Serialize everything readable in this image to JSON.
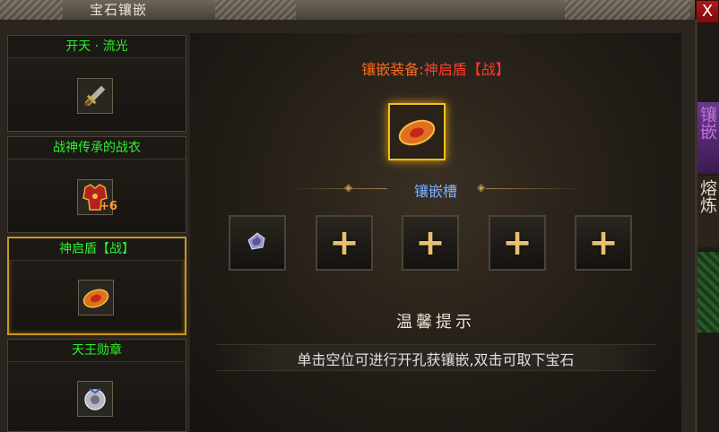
{
  "window": {
    "title": "宝石镶嵌",
    "close_label": "X"
  },
  "sidebar": {
    "items": [
      {
        "label": "开天 · 流光",
        "icon": "sword-icon",
        "selected": false
      },
      {
        "label": "战神传承的战衣",
        "icon": "armor-icon",
        "badge": "+6",
        "selected": false
      },
      {
        "label": "神启盾【战】",
        "icon": "shield-icon",
        "selected": true
      },
      {
        "label": "天王勋章",
        "icon": "medal-icon",
        "selected": false
      }
    ]
  },
  "main": {
    "equip_prefix": "镶嵌装备:",
    "equip_name": "神启盾【战】",
    "slots_label": "镶嵌槽",
    "slots": [
      {
        "state": "gem",
        "icon": "gem-icon"
      },
      {
        "state": "empty",
        "icon": "plus-icon",
        "symbol": "+"
      },
      {
        "state": "empty",
        "icon": "plus-icon",
        "symbol": "+"
      },
      {
        "state": "empty",
        "icon": "plus-icon",
        "symbol": "+"
      },
      {
        "state": "empty",
        "icon": "plus-icon",
        "symbol": "+"
      }
    ],
    "tip_title": "温馨提示",
    "tip_text": "单击空位可进行开孔获镶嵌,双击可取下宝石"
  },
  "right_panel": {
    "tab1": "镶嵌",
    "tab2": "熔炼"
  }
}
